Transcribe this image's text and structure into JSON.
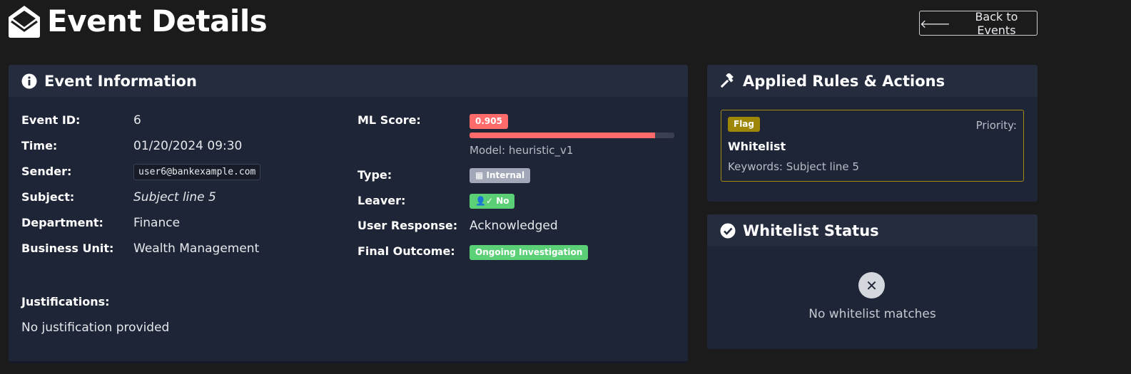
{
  "header": {
    "title": "Event Details",
    "back_label": "Back to Events"
  },
  "event_info": {
    "title": "Event Information",
    "fields": {
      "event_id": {
        "label": "Event ID:",
        "value": "6"
      },
      "time": {
        "label": "Time:",
        "value": "01/20/2024 09:30"
      },
      "sender": {
        "label": "Sender:",
        "value": "user6@bankexample.com"
      },
      "subject": {
        "label": "Subject:",
        "value": "Subject line 5"
      },
      "department": {
        "label": "Department:",
        "value": "Finance"
      },
      "business_unit": {
        "label": "Business Unit:",
        "value": "Wealth Management"
      },
      "ml_score": {
        "label": "ML Score:",
        "value": "0.905",
        "fraction": 0.905,
        "model": "Model: heuristic_v1"
      },
      "type": {
        "label": "Type:",
        "value": "Internal"
      },
      "leaver": {
        "label": "Leaver:",
        "value": "No"
      },
      "user_response": {
        "label": "User Response:",
        "value": "Acknowledged"
      },
      "final_outcome": {
        "label": "Final Outcome:",
        "value": "Ongoing Investigation"
      }
    },
    "justifications": {
      "label": "Justifications:",
      "value": "No justification provided"
    }
  },
  "rules": {
    "title": "Applied Rules & Actions",
    "items": [
      {
        "action": "Flag",
        "priority_label": "Priority:",
        "name": "Whitelist",
        "keywords": "Keywords: Subject line 5"
      }
    ]
  },
  "whitelist": {
    "title": "Whitelist Status",
    "message": "No whitelist matches"
  },
  "colors": {
    "background": "#1b1b1b",
    "card": "#1e2536",
    "card_header": "#242c3e",
    "danger": "#ff6b6b",
    "success": "#5cd076",
    "secondary": "#a3a8b8",
    "warning": "#9e8607"
  }
}
